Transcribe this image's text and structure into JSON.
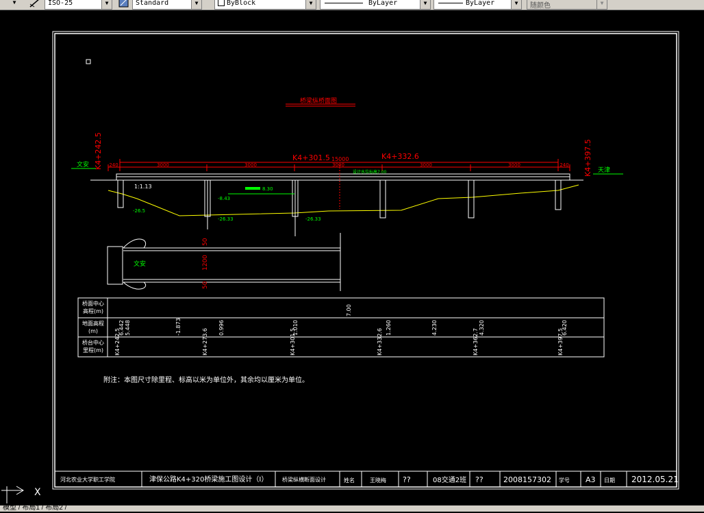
{
  "toolbar": {
    "dimstyle": "ISO-25",
    "textstyle": "Standard",
    "color": "ByBlock",
    "linetype": "ByLayer",
    "lineweight": "ByLayer",
    "plotstyle": "随颜色"
  },
  "drawing": {
    "title": "桥梁纵桥面图",
    "chainage_left": "K4+242.5",
    "chainage_right": "K4+397.5",
    "chainage_mid1": "K4+301.5",
    "chainage_mid2": "K4+332.6",
    "total_len": "15000",
    "span_lens": [
      "240",
      "3000",
      "3000",
      "3000",
      "3000",
      "3000",
      "240"
    ],
    "town_left": "文安",
    "town_right": "天津",
    "water_label": "设计水位标高7.00",
    "level_label": "8.30",
    "slope_label": "1:1.13",
    "elev1": "-26.5",
    "elev2": "-8.43",
    "elev3": "-26.33",
    "elev4": "-26.33",
    "plan_town": "文安",
    "plan_dims": [
      "50",
      "1200",
      "50"
    ]
  },
  "table": {
    "row1_label": [
      "桥面中心",
      "高程(m)"
    ],
    "row2_label": [
      "地面高程",
      "(m)"
    ],
    "row3_label": [
      "桥台中心",
      "里程(m)"
    ],
    "bridge_elev": "7.00",
    "ground_elev": [
      "6.442",
      "5.448",
      "-1.873",
      "0.996",
      "1.010",
      "1.260",
      "4.230",
      "4.320",
      "6.420"
    ],
    "chainage": [
      "K4+242.5",
      "K4+273.6",
      "K4+301.5",
      "K4+332.6",
      "K4+362.7",
      "K4+397.5"
    ]
  },
  "note": "附注：本图尺寸除里程、标高以米为单位外，其余均以厘米为单位。",
  "title_block": {
    "school": "河北农业大学职工学院",
    "project": "津保公路K4+320桥梁施工图设计（I）",
    "sheet": "桥梁纵横断面设计",
    "field1": "姓名",
    "field2": "王晓梅",
    "q1": "??",
    "class": "08交通2班",
    "q2": "??",
    "student_no": "2008157302",
    "field3": "学号",
    "size": "A3",
    "field4": "日期",
    "date": "2012.05.21"
  },
  "tabs": "模型 / 布局1 / 布局2 /",
  "ucs_x": "X",
  "colors": {
    "line": "#ffffff",
    "red": "#ff0000",
    "green": "#00ff00",
    "yellow": "#ffff00"
  }
}
